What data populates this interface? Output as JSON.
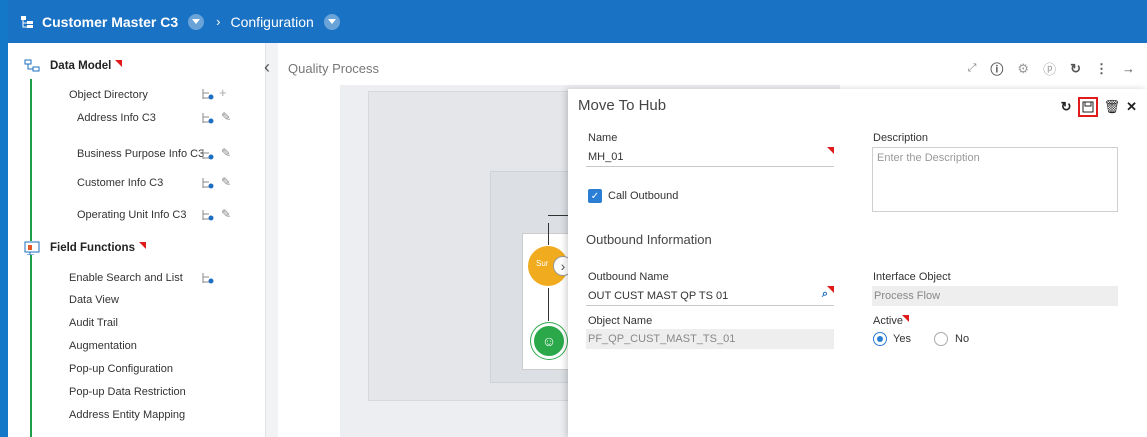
{
  "header": {
    "app_title": "Customer Master C3",
    "breadcrumb_separator": "›",
    "breadcrumb_current": "Configuration"
  },
  "sidebar": {
    "data_model_label": "Data Model",
    "field_functions_label": "Field Functions",
    "data_model_items": [
      "Object Directory",
      "Address Info C3",
      "Business Purpose Info C3",
      "Customer Info C3",
      "Operating Unit Info C3"
    ],
    "field_function_items": [
      "Enable Search and List",
      "Data View",
      "Audit Trail",
      "Augmentation",
      "Pop-up Configuration",
      "Pop-up Data Restriction",
      "Address Entity Mapping"
    ]
  },
  "canvas": {
    "title": "Quality Process",
    "collapse_glyph": "‹",
    "node_label": "Sur"
  },
  "panel": {
    "title": "Move To Hub",
    "name_label": "Name",
    "name_value": "MH_01",
    "description_label": "Description",
    "description_placeholder": "Enter the Description",
    "call_outbound_label": "Call Outbound",
    "outbound_section": "Outbound Information",
    "outbound_name_label": "Outbound Name",
    "outbound_name_value": "OUT CUST MAST QP TS 01",
    "interface_object_label": "Interface Object",
    "interface_object_value": "Process Flow",
    "object_name_label": "Object Name",
    "object_name_value": "PF_QP_CUST_MAST_TS_01",
    "active_label": "Active",
    "active_yes": "Yes",
    "active_no": "No"
  },
  "colors": {
    "header_bg": "#1a72c4",
    "accent": "#2a7fd4",
    "required_marker": "#e01b1b",
    "tree_line": "#1e9e48"
  }
}
